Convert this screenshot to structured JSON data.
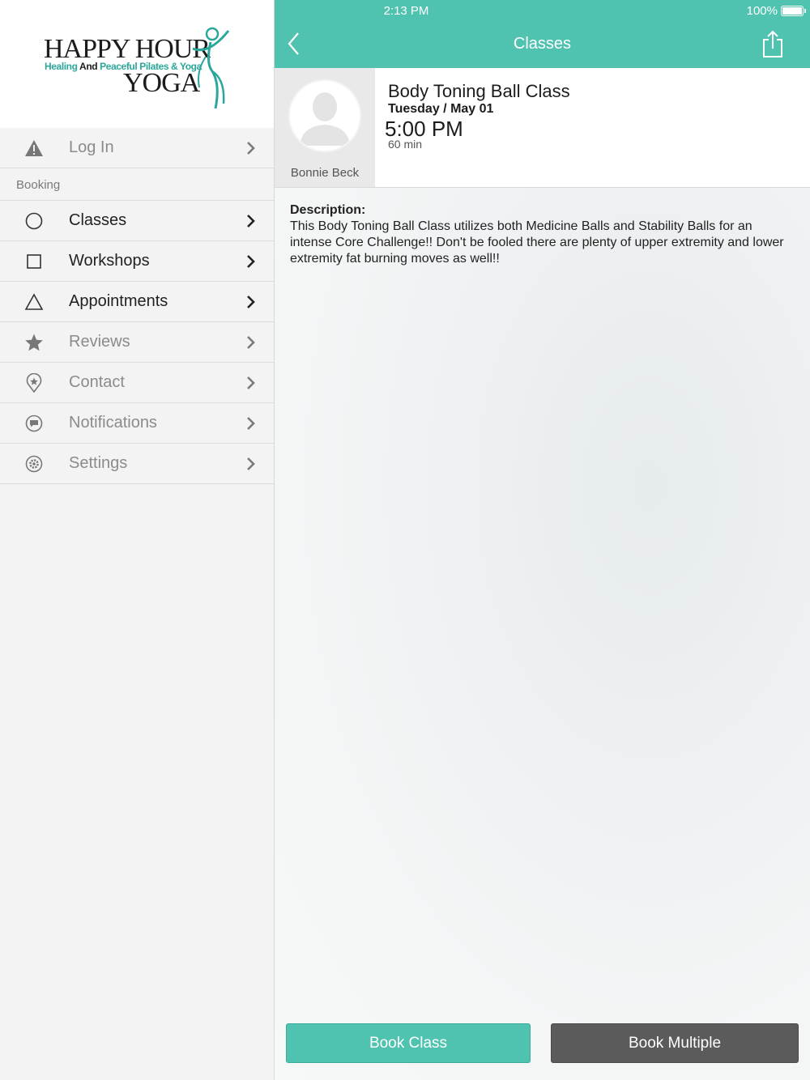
{
  "status_bar": {
    "time": "2:13 PM",
    "battery": "100%"
  },
  "logo": {
    "line1": "HAPPY HOUR",
    "tagline_part1": "Healing",
    "tagline_part2": "And",
    "tagline_part3": "Peaceful",
    "tagline_part4": "Pilates & Yoga",
    "line3": "YOGA"
  },
  "sidebar": {
    "login": {
      "label": "Log In",
      "icon": "warning-icon"
    },
    "section_label": "Booking",
    "items": [
      {
        "label": "Classes",
        "icon": "circle-icon",
        "enabled": true
      },
      {
        "label": "Workshops",
        "icon": "square-icon",
        "enabled": true
      },
      {
        "label": "Appointments",
        "icon": "triangle-icon",
        "enabled": true
      },
      {
        "label": "Reviews",
        "icon": "star-icon",
        "enabled": false
      },
      {
        "label": "Contact",
        "icon": "location-pin-icon",
        "enabled": false
      },
      {
        "label": "Notifications",
        "icon": "chat-bubble-icon",
        "enabled": false
      },
      {
        "label": "Settings",
        "icon": "gear-icon",
        "enabled": false
      }
    ]
  },
  "navbar": {
    "title": "Classes"
  },
  "class": {
    "name": "Body Toning Ball Class",
    "date": "Tuesday / May 01",
    "time": "5:00 PM",
    "duration": "60 min",
    "instructor": "Bonnie Beck"
  },
  "description": {
    "label": "Description:",
    "text": "This Body Toning Ball Class utilizes both Medicine Balls and Stability Balls for an intense Core Challenge!! Don't be fooled there are plenty of upper extremity and lower extremity fat burning moves as well!!"
  },
  "buttons": {
    "book": "Book Class",
    "book_multiple": "Book Multiple"
  },
  "colors": {
    "accent": "#4fc3b0",
    "dark_button": "#5b5b5b"
  }
}
